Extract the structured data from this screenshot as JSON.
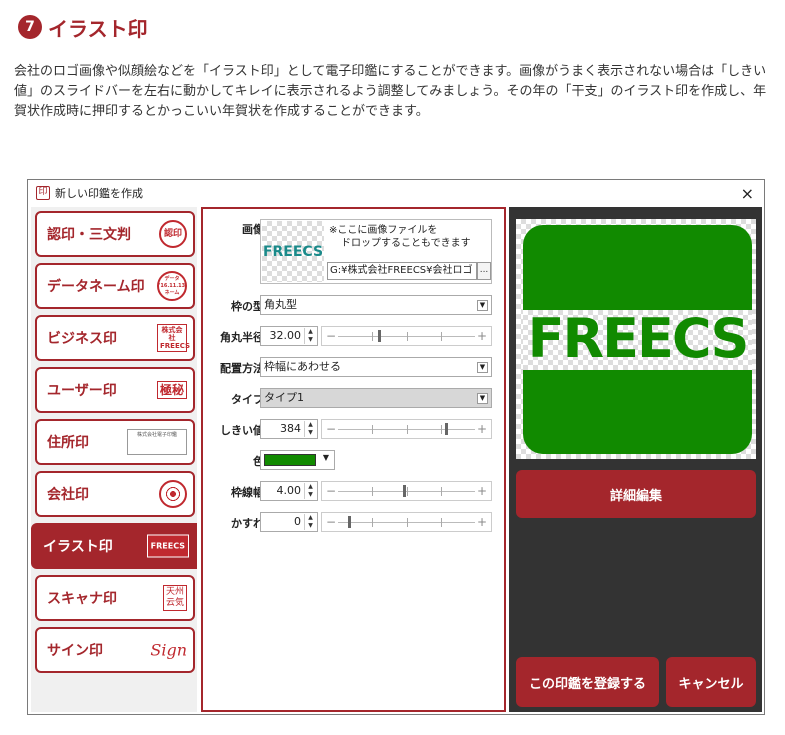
{
  "article": {
    "number": "7",
    "title": "イラスト印",
    "body": "会社のロゴ画像や似顔絵などを「イラスト印」として電子印鑑にすることができます。画像がうまく表示されない場合は「しきい値」のスライドバーを左右に動かしてキレイに表示されるよう調整してみましょう。その年の「干支」のイラスト印を作成し、年賀状作成時に押印するとかっこいい年賀状を作成することができます。"
  },
  "window": {
    "icon_glyph": "印",
    "title": "新しい印鑑を作成",
    "close": "×"
  },
  "menu": {
    "items": [
      {
        "label": "認印・三文判",
        "thumb": "認印",
        "thumb_icon": "round-seal-icon"
      },
      {
        "label": "データネーム印",
        "thumb": "データ '16.11.13 ネーム",
        "thumb_icon": "date-seal-icon"
      },
      {
        "label": "ビジネス印",
        "thumb": "株式会社 FREECS",
        "thumb_icon": "square-seal-icon"
      },
      {
        "label": "ユーザー印",
        "thumb": "極秘",
        "thumb_icon": "stamp-icon"
      },
      {
        "label": "住所印",
        "thumb": "株式会社電子印鑑",
        "thumb_icon": "address-stamp-icon"
      },
      {
        "label": "会社印",
        "thumb": "",
        "thumb_icon": "company-seal-icon"
      },
      {
        "label": "イラスト印",
        "thumb": "FREECS",
        "thumb_icon": "illustration-seal-icon",
        "active": true
      },
      {
        "label": "スキャナ印",
        "thumb": "天州 云気",
        "thumb_icon": "scanner-seal-icon"
      },
      {
        "label": "サイン印",
        "thumb": "Sign",
        "thumb_icon": "signature-icon"
      }
    ]
  },
  "props": {
    "image_label": "画像",
    "image_thumb_text": "FREECS",
    "drop_hint_line1": "※ここに画像ファイルを",
    "drop_hint_line2": "ドロップすることもできます",
    "path_value": "G:¥株式会社FREECS¥会社ロゴ",
    "browse": "...",
    "frame_label": "枠の型",
    "frame_value": "角丸型",
    "radius_label": "角丸半径",
    "radius_value": "32.00",
    "radius_fraction": 0.3,
    "layout_label": "配置方法",
    "layout_value": "枠幅にあわせる",
    "type_label": "タイプ",
    "type_value": "タイプ1",
    "threshold_label": "しきい値",
    "threshold_value": "384",
    "threshold_fraction": 0.79,
    "color_label": "色",
    "color_value": "#118a00",
    "border_label": "枠線幅",
    "border_value": "4.00",
    "border_fraction": 0.48,
    "blur_label": "かすれ",
    "blur_value": "0",
    "blur_fraction": 0.08,
    "minus": "−",
    "plus": "+"
  },
  "preview": {
    "stamp_text": "FREECS",
    "stamp_color": "#118a00",
    "detail_button": "詳細編集",
    "register_button": "この印鑑を登録する",
    "cancel_button": "キャンセル"
  },
  "colors": {
    "accent": "#a4262c",
    "preview_bg": "#333333"
  }
}
